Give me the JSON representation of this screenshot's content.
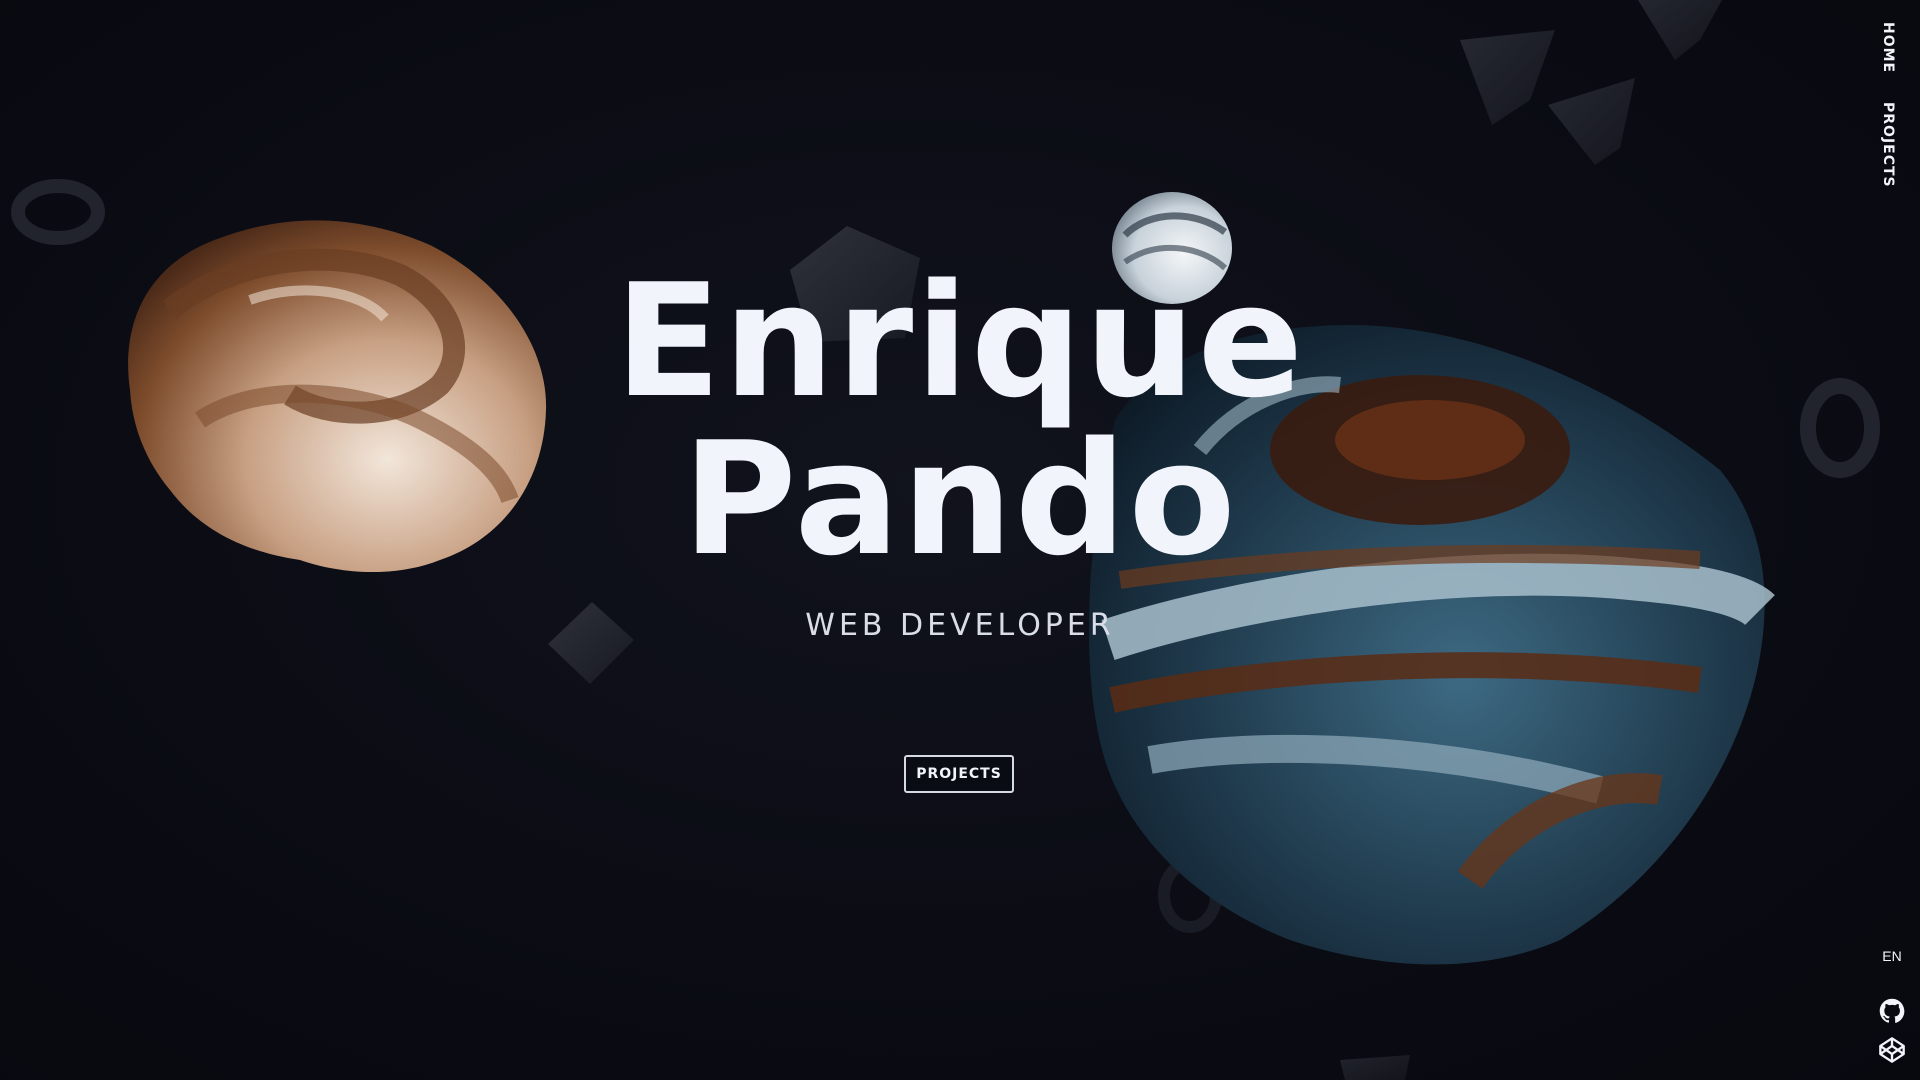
{
  "hero": {
    "name_line1": "Enrique",
    "name_line2": "Pando",
    "role": "WEB DEVELOPER",
    "cta_label": "PROJECTS"
  },
  "nav": {
    "items": [
      {
        "label": "HOME"
      },
      {
        "label": "PROJECTS"
      }
    ]
  },
  "language": "EN",
  "social": {
    "icons": [
      "github-icon",
      "codepen-icon"
    ]
  },
  "colors": {
    "background": "#0b0c13",
    "text": "#f1f4fa",
    "orb_brown": "#8a5a3c",
    "orb_blue": "#4f7b92"
  }
}
